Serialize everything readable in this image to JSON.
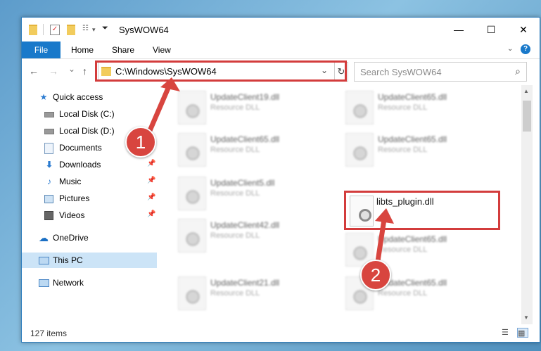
{
  "window": {
    "title": "SysWOW64",
    "minimize": "—",
    "maximize": "☐",
    "close": "✕"
  },
  "ribbon": {
    "tabs": [
      "File",
      "Home",
      "Share",
      "View"
    ],
    "help": "?"
  },
  "navigation": {
    "back": "←",
    "forward": "→",
    "recent": "⌄",
    "up": "↑"
  },
  "address_bar": {
    "path": "C:\\Windows\\SysWOW64"
  },
  "search": {
    "placeholder": "Search SysWOW64"
  },
  "sidebar": {
    "items": [
      {
        "label": "Quick access",
        "icon": "star-icon",
        "pinned": false
      },
      {
        "label": "Local Disk (C:)",
        "icon": "drive-icon",
        "pinned": false
      },
      {
        "label": "Local Disk (D:)",
        "icon": "drive-icon",
        "pinned": false
      },
      {
        "label": "Documents",
        "icon": "document-icon",
        "pinned": true
      },
      {
        "label": "Downloads",
        "icon": "download-icon",
        "pinned": true
      },
      {
        "label": "Music",
        "icon": "music-icon",
        "pinned": true
      },
      {
        "label": "Pictures",
        "icon": "picture-icon",
        "pinned": true
      },
      {
        "label": "Videos",
        "icon": "video-icon",
        "pinned": true
      },
      {
        "label": "OneDrive",
        "icon": "cloud-icon",
        "pinned": false
      },
      {
        "label": "This PC",
        "icon": "computer-icon",
        "pinned": false,
        "selected": true
      },
      {
        "label": "Network",
        "icon": "network-icon",
        "pinned": false
      }
    ]
  },
  "files": [
    {
      "name": "UpdateClient19.dll",
      "type": "Resource DLL"
    },
    {
      "name": "UpdateClient65.dll",
      "type": "Resource DLL"
    },
    {
      "name": "UpdateClient65.dll",
      "type": "Resource DLL"
    },
    {
      "name": "UpdateClient65.dll",
      "type": "Resource DLL"
    },
    {
      "name": "UpdateClient5.dll",
      "type": "Resource DLL"
    },
    {
      "name": "libts_plugin.dll",
      "type": "",
      "selected": true
    },
    {
      "name": "UpdateClient42.dll",
      "type": "Resource DLL"
    },
    {
      "name": "UpdateClient65.dll",
      "type": "Resource DLL"
    },
    {
      "name": "UpdateClient21.dll",
      "type": "Resource DLL"
    },
    {
      "name": "UpdateClient65.dll",
      "type": "Resource DLL"
    }
  ],
  "status": {
    "item_count": "127 items"
  },
  "annotations": {
    "step1": "1",
    "step2": "2",
    "color": "#d8453f"
  }
}
